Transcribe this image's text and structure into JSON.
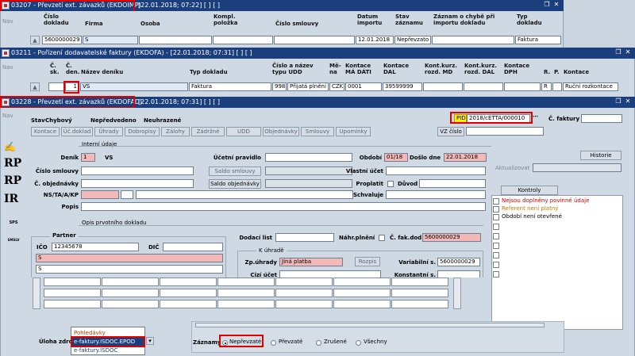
{
  "window1": {
    "title": "03207 - Převzetí ext. závazků (EKDOIMP)",
    "title_suffix": "[22.01.2018; 07:22]  [ ]  [ ]",
    "nav": "Nav",
    "columns": {
      "cislo_dokladu": "Číslo dokladu",
      "firma": "Firma",
      "osoba": "Osoba",
      "kompl_polozka": "Kompl. položka",
      "cislo_smlouvy": "Číslo smlouvy",
      "datum_importu": "Datum importu",
      "stav_zaznamu": "Stav záznamu",
      "zaznam_o_chybe": "Záznam o chybě při importu dokladu",
      "typ_dokladu": "Typ dokladu"
    },
    "row": {
      "cislo_dokladu": "5600000029",
      "firma": "S",
      "datum_importu": "12.01.2018",
      "stav": "Nepřevzato",
      "typ": "Faktura"
    }
  },
  "window2": {
    "title": "03211 - Pořízení dodavatelské faktury (EKDOFA) - [22.01.2018; 07:31]  [ ]  [ ]",
    "nav": "Nav",
    "columns": {
      "c_sk": "Č. sk.",
      "c_den": "Č. den.",
      "nazev_deniku": "Název deníku",
      "typ_dokladu": "Typ dokladu",
      "cislo_typu": "Číslo a název typu UDD",
      "mena": "Mě- na",
      "kontace_ma_dati": "Kontace MÁ DÁTI",
      "kontace_dal": "Kontace DAL",
      "kont_kurz_md": "Kont.kurz. rozd. MD",
      "kont_kurz_dal": "Kont.kurz. rozd. DAL",
      "kontace_dph": "Kontace DPH",
      "r": "R.",
      "p": "P.",
      "kontace": "Kontace"
    },
    "row": {
      "c_den": "1",
      "nazev": "VS",
      "typ": "Faktura",
      "typ_cislo": "998",
      "typ_nazev": "Přijatá plnění z",
      "mena": "CZK",
      "md": "0001",
      "dal": "39599999",
      "r": "R",
      "kontace": "Ruční rozkontace"
    }
  },
  "window3": {
    "title": "03228 - Převzetí ext. závazků (EKDOFAD)",
    "title_suffix": "[22.01.2018; 07:31]  [ ]  [ ]",
    "nav": "Nav",
    "stav_label": "Stav",
    "stav_values": [
      "Chybový",
      "Nepředvedeno",
      "Neuhrazené"
    ],
    "pid_label": "PID",
    "pid_value": "2018/cETTA/000010",
    "faktury_label": "Č. faktury",
    "vz_cislo": "VZ číslo",
    "tabs": [
      "Kontace",
      "Úč.doklad",
      "Úhrady",
      "Dobropisy",
      "Zálohy",
      "Zádržné",
      "UDD",
      "Objednávky",
      "Smlouvy",
      "Upomínky"
    ],
    "interni_udaje": "Interní údaje",
    "denik_label": "Deník",
    "denik_value": "1",
    "denik_name": "VS",
    "ucetni_pravidlo": "Účetní pravidlo",
    "obdobi_label": "Období",
    "obdobi_value": "01/18",
    "doslo_dne_label": "Došlo dne",
    "doslo_dne_value": "22.01.2018",
    "historie": "Historie",
    "cislo_smlouvy": "Číslo smlouvy",
    "saldo_smlouvy": "Saldo smlouvy",
    "vlastni_ucet": "Vlastní účet",
    "aktualizovat": "Aktualizovat",
    "c_objednavky": "Č. objednávky",
    "saldo_objednavky": "Saldo objednávky",
    "proplatit": "Proplatit",
    "duvod": "Důvod",
    "ns_label": "NS/TA/A/KP",
    "schvaluje": "Schvaluje",
    "popis": "Popis",
    "kontroly": "Kontroly",
    "kontroly_items": [
      {
        "text": "Nejsou doplněny povinné údaje",
        "color": "#d40000"
      },
      {
        "text": "Referent není platný",
        "color": "#c07a00"
      },
      {
        "text": "Období není otevřené",
        "color": "#000000"
      }
    ],
    "opis_title": "Opis prvotního dokladu",
    "partner": "Partner",
    "ico_label": "IČO",
    "ico_value": "12345678",
    "dic_label": "DIČ",
    "partner_name": "S",
    "partner_addr": "S",
    "dodaci_list": "Dodací list",
    "nahr_plneni": "Náhr.plnění",
    "c_fak_dod": "Č. fak.dod",
    "c_fak_dod_value": "5600000029",
    "k_uhrade": "K úhradě",
    "zp_uhrady": "Zp.úhrady",
    "zp_uhrady_value": "Jiná platba",
    "rozpis": "Rozpis",
    "variabilni": "Variabilní s.",
    "variabilni_value": "5600000029",
    "cizi_ucet": "Cizí účet",
    "konstantni": "Konstantní s.",
    "uloha_label": "Úloha zdroj",
    "uloha_options": [
      "Pohledávky",
      "e-faktury.ISDOC.EPOD",
      "e-faktury.ISDOC"
    ],
    "uloha_selected": "e-faktury.ISDOC.EPOD",
    "zaznamy_label": "Záznamy",
    "zaznamy_options": [
      "Nepřevzaté",
      "Převzaté",
      "Zrušené",
      "Všechny"
    ],
    "zaznamy_selected": "Nepřevzaté"
  },
  "side_icons": [
    "RP",
    "RP",
    "IR",
    "SPS",
    "SMSLV"
  ],
  "colors": {
    "titlebar": "#1b3f7c",
    "highlight": "#e00000",
    "pink": "#f3b9b9",
    "yellow": "#fff200",
    "selected": "#1b3f7c"
  }
}
